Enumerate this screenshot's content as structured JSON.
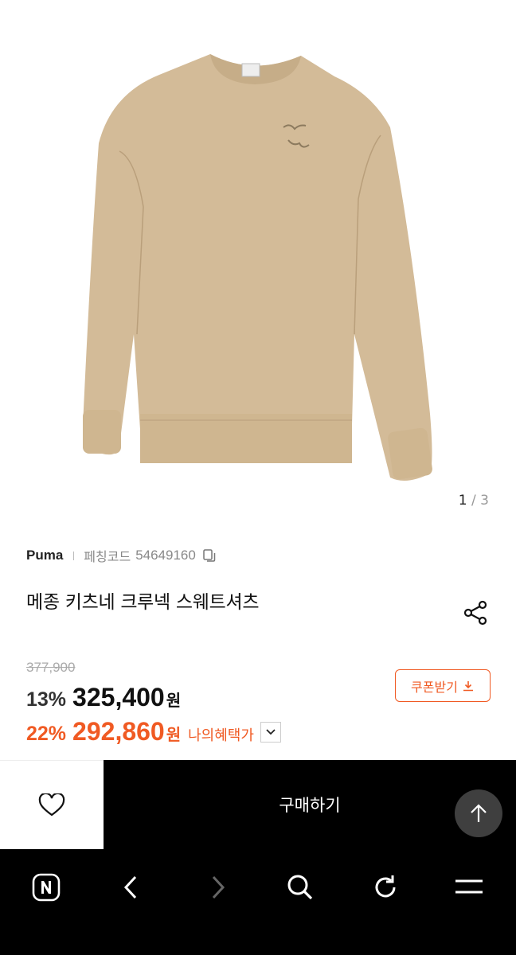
{
  "gallery": {
    "current": "1",
    "separator": " / ",
    "total": "3",
    "image_icon": "sweatshirt-image"
  },
  "product": {
    "brand": "Puma",
    "code_label": "페칭코드",
    "code_value": "54649160",
    "title": "메종 키츠네 크루넥 스웨트셔츠",
    "original_price": "377,900",
    "discount_rate": "13%",
    "price": "325,400",
    "currency": "원",
    "benefit_rate": "22%",
    "benefit_price": "292,860",
    "benefit_label": "나의혜택가"
  },
  "coupon": {
    "label": "쿠폰받기"
  },
  "buy": {
    "label": "구매하기"
  },
  "colors": {
    "accent": "#f05a23",
    "buy_bg": "#000000",
    "product_beige": "#d3bb98"
  },
  "nav": [
    "naver-n-icon",
    "back-icon",
    "forward-icon",
    "search-icon",
    "refresh-icon",
    "menu-icon"
  ]
}
